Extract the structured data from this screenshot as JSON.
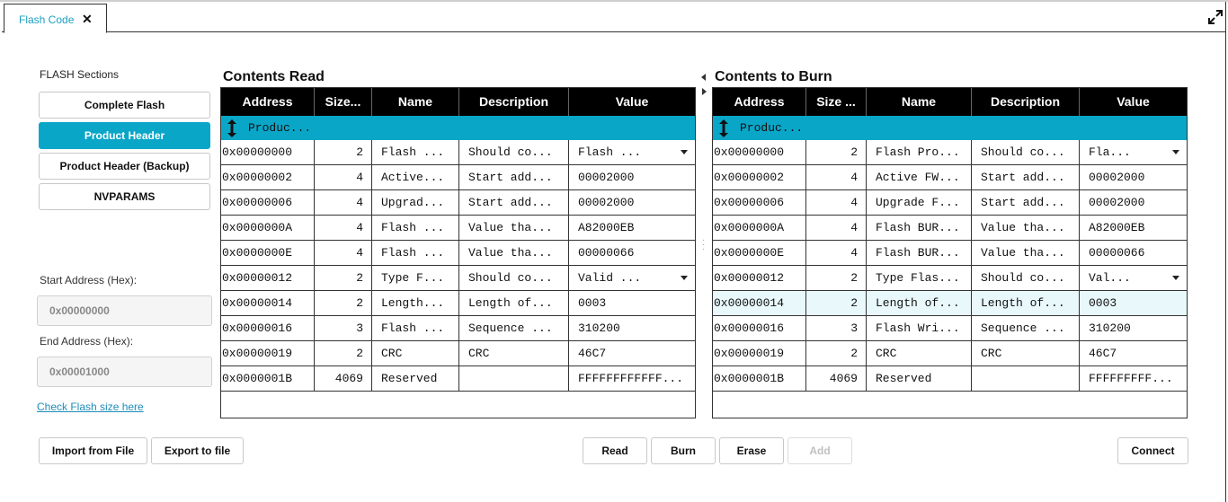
{
  "tab": {
    "title": "Flash Code",
    "close": "✕"
  },
  "sidebar": {
    "heading": "FLASH Sections",
    "sections": [
      {
        "label": "Complete Flash",
        "active": false
      },
      {
        "label": "Product Header",
        "active": true
      },
      {
        "label": "Product Header (Backup)",
        "active": false
      },
      {
        "label": "NVPARAMS",
        "active": false
      }
    ],
    "start_label": "Start Address (Hex):",
    "start_value": "0x00000000",
    "end_label": "End Address (Hex):",
    "end_value": "0x00001000",
    "check_link": "Check Flash size here"
  },
  "read": {
    "title": "Contents Read",
    "headers": [
      "Address",
      "Size...",
      "Name",
      "Description",
      "Value"
    ],
    "group": "Produc...",
    "rows": [
      {
        "addr": "0x00000000",
        "size": "2",
        "name": "Flash ...",
        "desc": "Should co...",
        "value": "Flash ...",
        "select": true
      },
      {
        "addr": "0x00000002",
        "size": "4",
        "name": "Active...",
        "desc": "Start add...",
        "value": "00002000"
      },
      {
        "addr": "0x00000006",
        "size": "4",
        "name": "Upgrad...",
        "desc": "Start add...",
        "value": "00002000"
      },
      {
        "addr": "0x0000000A",
        "size": "4",
        "name": "Flash ...",
        "desc": "Value tha...",
        "value": "A82000EB"
      },
      {
        "addr": "0x0000000E",
        "size": "4",
        "name": "Flash ...",
        "desc": "Value tha...",
        "value": "00000066"
      },
      {
        "addr": "0x00000012",
        "size": "2",
        "name": "Type F...",
        "desc": "Should co...",
        "value": "Valid ...",
        "select": true
      },
      {
        "addr": "0x00000014",
        "size": "2",
        "name": "Length...",
        "desc": "Length of...",
        "value": "0003"
      },
      {
        "addr": "0x00000016",
        "size": "3",
        "name": "Flash ...",
        "desc": "Sequence ...",
        "value": "310200"
      },
      {
        "addr": "0x00000019",
        "size": "2",
        "name": "CRC",
        "desc": "CRC",
        "value": "46C7"
      },
      {
        "addr": "0x0000001B",
        "size": "4069",
        "name": "Reserved",
        "desc": "",
        "value": "FFFFFFFFFFFF..."
      }
    ]
  },
  "burn": {
    "title": "Contents to Burn",
    "headers": [
      "Address",
      "Size ...",
      "Name",
      "Description",
      "Value"
    ],
    "group": "Produc...",
    "rows": [
      {
        "addr": "0x00000000",
        "size": "2",
        "name": "Flash Pro...",
        "desc": "Should co...",
        "value": "Fla...",
        "select": true
      },
      {
        "addr": "0x00000002",
        "size": "4",
        "name": "Active FW...",
        "desc": "Start add...",
        "value": "00002000"
      },
      {
        "addr": "0x00000006",
        "size": "4",
        "name": "Upgrade F...",
        "desc": "Start add...",
        "value": "00002000"
      },
      {
        "addr": "0x0000000A",
        "size": "4",
        "name": "Flash BUR...",
        "desc": "Value tha...",
        "value": "A82000EB"
      },
      {
        "addr": "0x0000000E",
        "size": "4",
        "name": "Flash BUR...",
        "desc": "Value tha...",
        "value": "00000066"
      },
      {
        "addr": "0x00000012",
        "size": "2",
        "name": "Type Flas...",
        "desc": "Should co...",
        "value": "Val...",
        "select": true
      },
      {
        "addr": "0x00000014",
        "size": "2",
        "name": "Length of...",
        "desc": "Length of...",
        "value": "0003",
        "highlight": true
      },
      {
        "addr": "0x00000016",
        "size": "3",
        "name": "Flash Wri...",
        "desc": "Sequence ...",
        "value": "310200"
      },
      {
        "addr": "0x00000019",
        "size": "2",
        "name": "CRC",
        "desc": "CRC",
        "value": "46C7"
      },
      {
        "addr": "0x0000001B",
        "size": "4069",
        "name": "Reserved",
        "desc": "",
        "value": "FFFFFFFFF..."
      }
    ]
  },
  "actions": {
    "import": "Import from File",
    "export": "Export to file",
    "read": "Read",
    "burn": "Burn",
    "erase": "Erase",
    "add": "Add",
    "connect": "Connect"
  },
  "colors": {
    "accent": "#0aa6c8",
    "link": "#1d8db8",
    "header_bg": "#000000"
  }
}
